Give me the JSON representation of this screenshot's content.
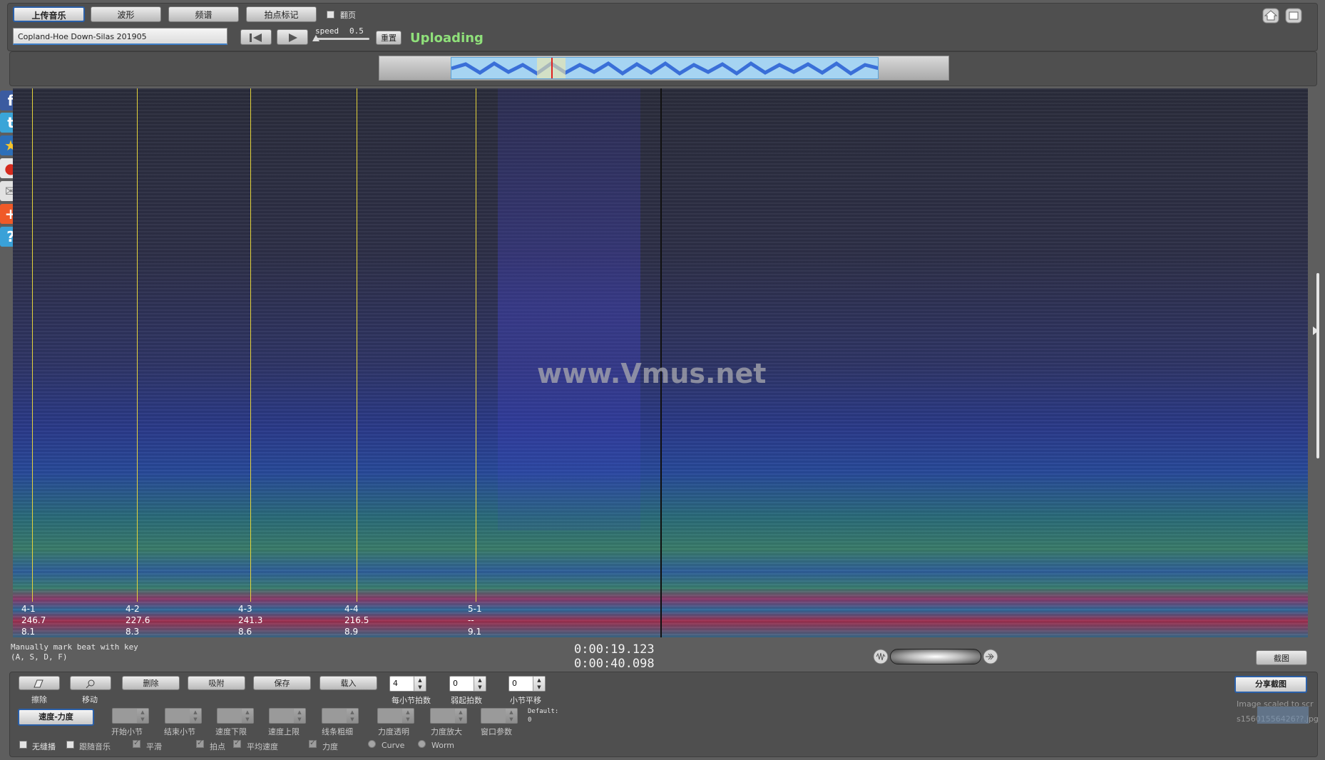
{
  "toolbar": {
    "upload_label": "上传音乐",
    "waveform_label": "波形",
    "spectrum_label": "频谱",
    "beatmark_label": "拍点标记",
    "flip_label": "翻页",
    "track_name": "Copland-Hoe Down-Silas 201905",
    "speed_label": "speed",
    "speed_value": "0.5",
    "reset_label": "重置",
    "status": "Uploading"
  },
  "spectrogram": {
    "watermark": "www.Vmus.net",
    "beats": [
      {
        "bar": "4-1",
        "tempo": "246.7",
        "time": "8.1"
      },
      {
        "bar": "4-2",
        "tempo": "227.6",
        "time": "8.3"
      },
      {
        "bar": "4-3",
        "tempo": "241.3",
        "time": "8.6"
      },
      {
        "bar": "4-4",
        "tempo": "216.5",
        "time": "8.9"
      },
      {
        "bar": "5-1",
        "tempo": "--",
        "time": "9.1"
      }
    ]
  },
  "info": {
    "hint_line1": "Manually mark beat with key",
    "hint_line2": "(A, S, D, F)",
    "current_time": "0:00:19.123",
    "total_time": "0:00:40.098",
    "screenshot_label": "截图"
  },
  "controls": {
    "erase_label": "擦除",
    "move_label": "移动",
    "delete_label": "删除",
    "snap_label": "吸附",
    "save_label": "保存",
    "load_label": "载入",
    "beats_per_bar_label": "每小节拍数",
    "beats_per_bar_value": "4",
    "pickup_label": "弱起拍数",
    "pickup_value": "0",
    "bar_offset_label": "小节平移",
    "bar_offset_value": "0",
    "tempo_dynamics_label": "速度-力度",
    "start_bar_label": "开始小节",
    "end_bar_label": "结束小节",
    "tempo_min_label": "速度下限",
    "tempo_max_label": "速度上限",
    "line_width_label": "线条粗细",
    "dyn_opacity_label": "力度透明",
    "dyn_scale_label": "力度放大",
    "window_param_label": "窗口参数",
    "default_label": "Default:",
    "default_value": "0",
    "no_loop_label": "无缝播",
    "follow_music_label": "跟随音乐",
    "smooth_label": "平滑",
    "beat_points_label": "拍点",
    "avg_tempo_label": "平均速度",
    "dynamics_label": "力度",
    "curve_label": "Curve",
    "worm_label": "Worm",
    "share_label": "分享截图",
    "image_note_line1": "Image scaled to scr",
    "image_note_line2": "s15601556426??.jpg"
  },
  "icons": [
    "facebook-icon",
    "twitter-icon",
    "star-icon",
    "weibo-icon",
    "mail-icon",
    "plus-icon",
    "help-icon",
    "home-icon",
    "fullscreen-icon",
    "prev-icon",
    "play-icon",
    "eraser-icon",
    "move-icon",
    "zoom-out-icon",
    "zoom-in-icon"
  ]
}
